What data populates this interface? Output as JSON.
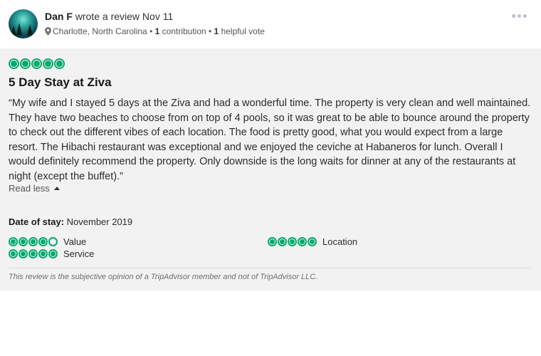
{
  "review": {
    "author_name": "Dan F",
    "action_text": " wrote a review Nov 11",
    "location": "Charlotte, North Carolina",
    "contributions_count": "1",
    "contributions_label": " contribution",
    "helpful_count": "1",
    "helpful_label": " helpful vote",
    "separator": " • ",
    "rating": 5,
    "title": "5 Day Stay at Ziva",
    "body": "“My wife and I stayed 5 days at the Ziva and had a wonderful time. The property is very clean and well maintained. They have two beaches to choose from on top of 4 pools, so it was great to be able to bounce around the property to check out the different vibes of each location. The food is pretty good, what you would expect from a large resort. The Hibachi restaurant was exceptional and we enjoyed the ceviche at Habaneros for lunch. Overall I would definitely recommend the property. Only downside is the long waits for dinner at any of the restaurants at night (except the buffet).”",
    "read_less_label": "Read less",
    "date_of_stay_label": "Date of stay:",
    "date_of_stay_value": " November 2019",
    "sub_ratings": {
      "value": {
        "label": "Value",
        "rating": 4
      },
      "location": {
        "label": "Location",
        "rating": 5
      },
      "service": {
        "label": "Service",
        "rating": 5
      }
    },
    "disclaimer": "This review is the subjective opinion of a TripAdvisor member and not of TripAdvisor LLC."
  },
  "colors": {
    "bubble_green": "#00aa6c",
    "card_background": "#f2f2f2"
  },
  "icons": {
    "location": "map-pin-icon",
    "menu": "more-dots-icon",
    "collapse": "caret-up-icon"
  }
}
